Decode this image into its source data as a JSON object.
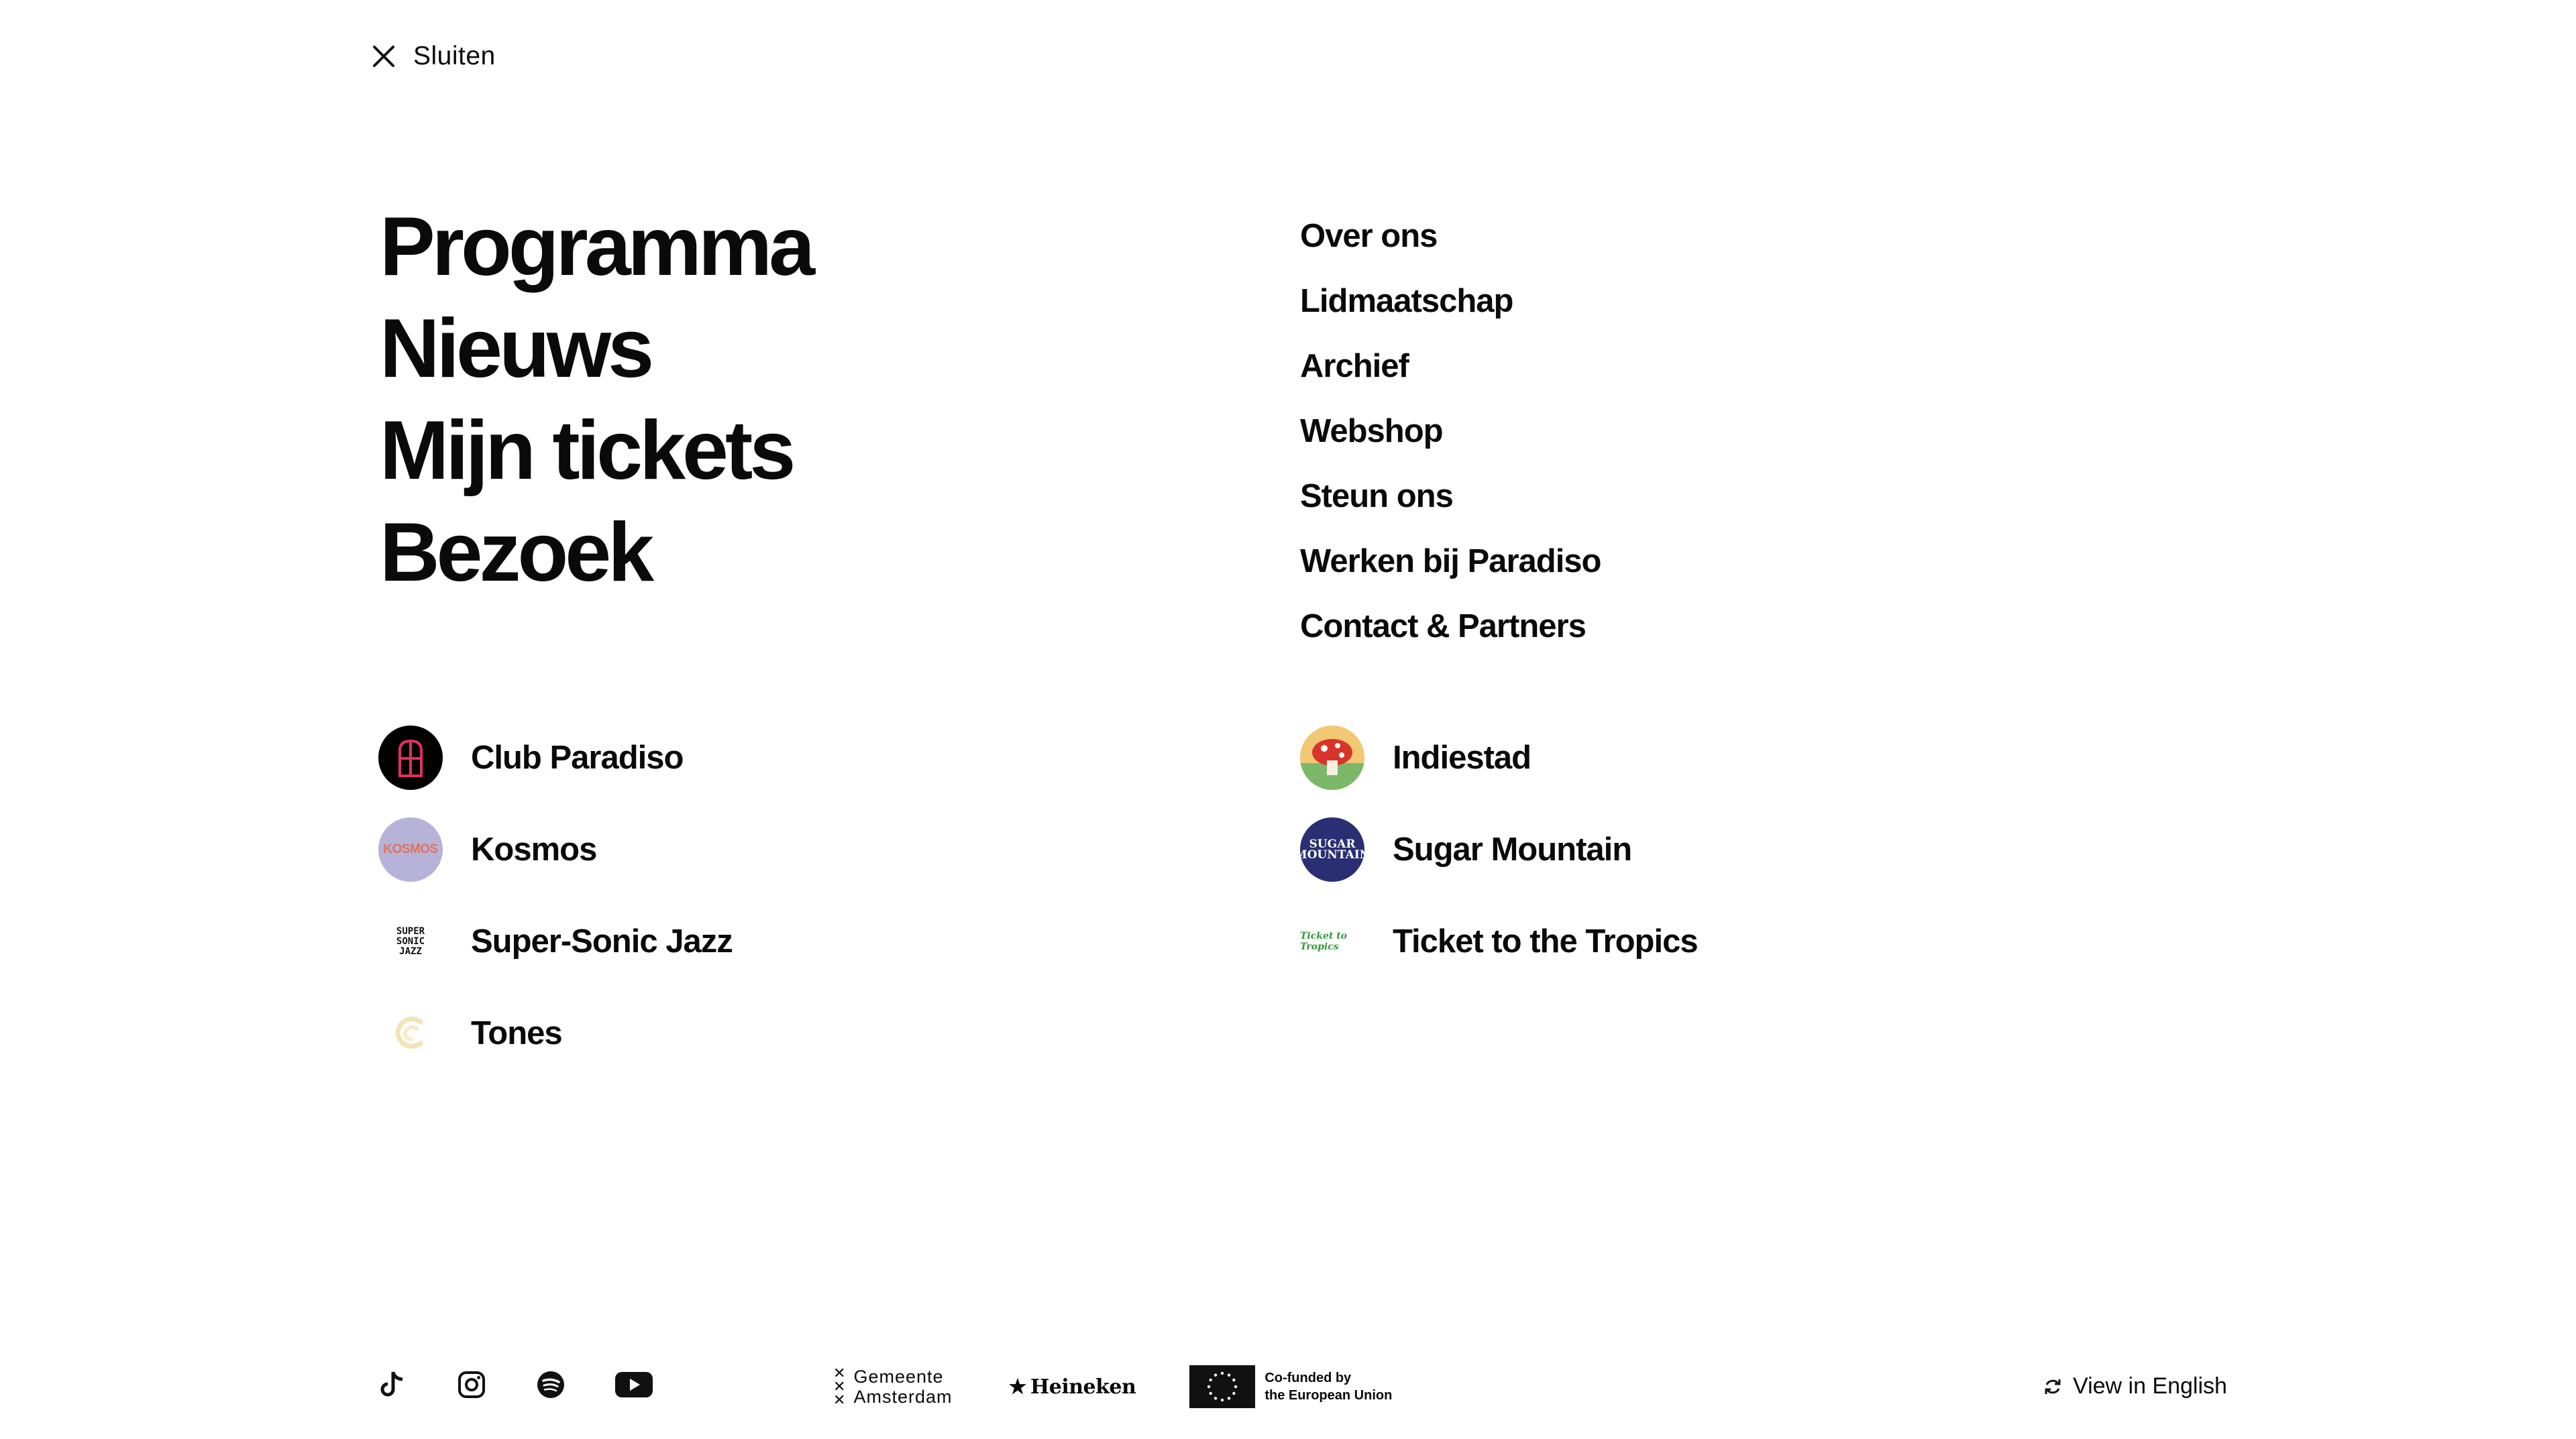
{
  "close": {
    "label": "Sluiten"
  },
  "primary_nav": [
    "Programma",
    "Nieuws",
    "Mijn tickets",
    "Bezoek"
  ],
  "secondary_nav": [
    "Over ons",
    "Lidmaatschap",
    "Archief",
    "Webshop",
    "Steun ons",
    "Werken bij Paradiso",
    "Contact & Partners"
  ],
  "brands_left": [
    {
      "name": "Club Paradiso",
      "icon": "club-paradiso-logo"
    },
    {
      "name": "Kosmos",
      "icon": "kosmos-logo",
      "logo_text": "KOSMOS"
    },
    {
      "name": "Super-Sonic Jazz",
      "icon": "super-sonic-jazz-logo",
      "logo_lines": [
        "SUPER",
        "SONIC",
        "JAZZ"
      ]
    },
    {
      "name": "Tones",
      "icon": "tones-logo"
    }
  ],
  "brands_right": [
    {
      "name": "Indiestad",
      "icon": "indiestad-logo"
    },
    {
      "name": "Sugar Mountain",
      "icon": "sugar-mountain-logo",
      "logo_lines": [
        "SUGAR",
        "MOUNTAIN"
      ]
    },
    {
      "name": "Ticket to the Tropics",
      "icon": "ticket-to-the-tropics-logo",
      "logo_text": "Ticket to Tropics"
    }
  ],
  "social_icons": [
    "tiktok-icon",
    "instagram-icon",
    "spotify-icon",
    "youtube-icon"
  ],
  "sponsors": {
    "gemeente": [
      "Gemeente",
      "Amsterdam"
    ],
    "heineken": "Heineken",
    "eu": [
      "Co-funded by",
      "the European Union"
    ]
  },
  "language": {
    "label": "View in English",
    "icon": "refresh-icon"
  },
  "colors": {
    "text": "#0a0a0a",
    "background": "#ffffff",
    "kosmos_bg": "#b7b2d8",
    "sugar_bg": "#2a2f73",
    "club_accent": "#e2305f"
  }
}
